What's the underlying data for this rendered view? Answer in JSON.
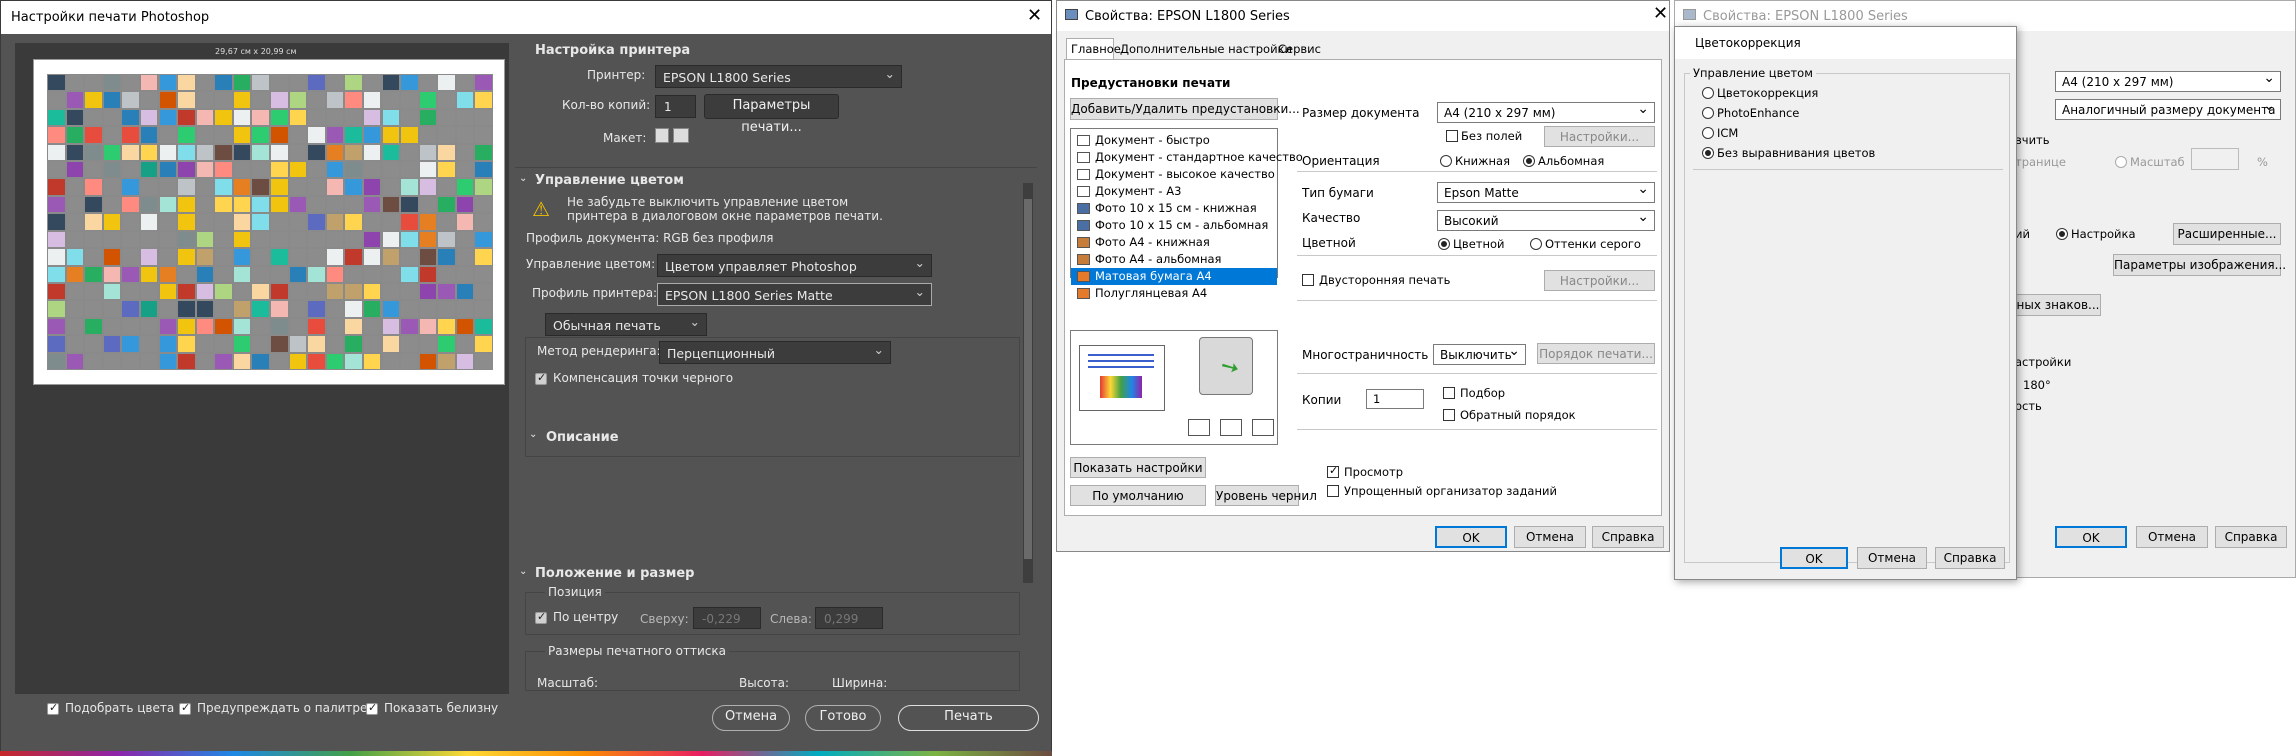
{
  "ps": {
    "title": "Настройки печати Photoshop",
    "preview_dim": "29,67 см x 20,99 см",
    "printer_section": "Настройка принтера",
    "printer_label": "Принтер:",
    "printer_value": "EPSON L1800 Series",
    "copies_label": "Кол-во копий:",
    "copies_value": "1",
    "print_settings_btn": "Параметры печати...",
    "layout_label": "Макет:",
    "color_mgmt_section": "Управление цветом",
    "warning": "Не забудьте выключить управление цветом принтера в диалоговом окне параметров печати.",
    "warning_line1": "Не забудьте выключить управление цветом",
    "warning_line2": "принтера в диалоговом окне параметров печати.",
    "doc_profile": "Профиль документа: RGB без профиля",
    "color_handling_label": "Управление цветом:",
    "color_handling_value": "Цветом управляет Photoshop",
    "printer_profile_label": "Профиль принтера:",
    "printer_profile_value": "EPSON L1800 Series Matte",
    "normal_print": "Обычная печать",
    "render_label": "Метод рендеринга:",
    "render_value": "Перцепционный",
    "bpc_label": "Компенсация точки черного",
    "description_section": "Описание",
    "position_section": "Положение и размер",
    "position_label": "Позиция",
    "center_label": "По центру",
    "top_label": "Сверху:",
    "top_value": "-0,229",
    "left_label": "Слева:",
    "left_value": "0,299",
    "print_size_label": "Размеры печатного оттиска",
    "scale_label": "Масштаб:",
    "height_label": "Высота:",
    "width_label": "Ширина:",
    "match_colors": "Подобрать цвета",
    "gamut_warning": "Предупреждать о палитре",
    "show_white": "Показать белизну",
    "cancel_btn": "Отмена",
    "done_btn": "Готово",
    "print_btn": "Печать"
  },
  "epson": {
    "title": "Свойства: EPSON L1800 Series",
    "tabs": [
      "Главное",
      "Дополнительные настройки",
      "Сервис"
    ],
    "presets_title": "Предустановки печати",
    "add_remove_btn": "Добавить/Удалить предустановки...",
    "presets": [
      "Документ - быстро",
      "Документ - стандартное качество",
      "Документ - высокое качество",
      "Документ - А3",
      "Фото 10 x 15 см - книжная",
      "Фото 10 x 15 см - альбомная",
      "Фото А4 - книжная",
      "Фото А4 - альбомная",
      "Матовая бумага А4",
      "Полуглянцевая А4"
    ],
    "doc_size_label": "Размер документа",
    "doc_size_value": "A4 (210 x 297 мм)",
    "borderless_label": "Без полей",
    "settings_btn": "Настройки...",
    "orientation_label": "Ориентация",
    "portrait_label": "Книжная",
    "landscape_label": "Альбомная",
    "paper_type_label": "Тип бумаги",
    "paper_type_value": "Epson Matte",
    "quality_label": "Качество",
    "quality_value": "Высокий",
    "color_label": "Цветной",
    "color_opt": "Цветной",
    "grayscale_opt": "Оттенки серого",
    "duplex_label": "Двусторонняя печать",
    "duplex_settings_btn": "Настройки...",
    "multipage_label": "Многостраничность",
    "multipage_value": "Выключить",
    "page_order_btn": "Порядок печати...",
    "copies_label": "Копии",
    "copies_value": "1",
    "collate_label": "Подбор",
    "reverse_label": "Обратный порядок",
    "preview_label": "Просмотр",
    "simple_job_label": "Упрощенный организатор заданий",
    "show_settings_btn": "Показать настройки",
    "default_btn": "По умолчанию",
    "ink_levels_btn": "Уровень чернил",
    "ok": "OK",
    "cancel": "Отмена",
    "help": "Справка"
  },
  "back": {
    "title": "Свойства: EPSON L1800 Series",
    "doc_size_value": "A4 (210 x 297 мм)",
    "output_value": "Аналогичный размеру документа",
    "frag_fit": "вчить",
    "frag_page": "транице",
    "scale_label": "Масштаб",
    "percent": "%",
    "frag_ii": "ий",
    "custom_label": "Настройка",
    "advanced_btn": "Расширенные...",
    "image_params_btn": "Параметры изображения...",
    "watermark_btn": "ных знаков...",
    "frag_settings": "астройки",
    "frag_rotate": "180°",
    "frag_mirror": "ость",
    "ok": "OK",
    "cancel": "Отмена",
    "help": "Справка"
  },
  "cc": {
    "title": "Цветокоррекция",
    "group": "Управление цветом",
    "options": [
      "Цветокоррекция",
      "PhotoEnhance",
      "ICM",
      "Без выравнивания цветов"
    ],
    "ok": "OK",
    "cancel": "Отмена",
    "help": "Справка"
  }
}
